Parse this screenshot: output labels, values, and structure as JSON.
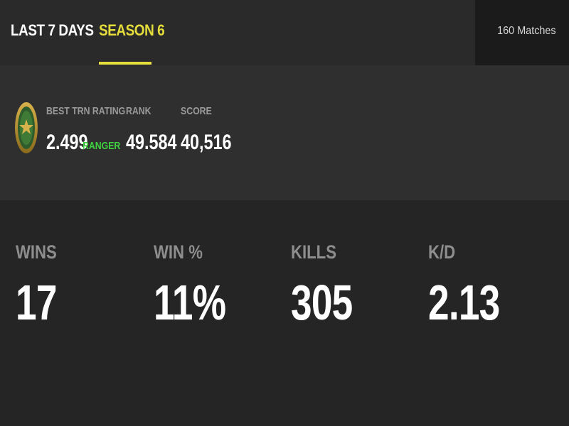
{
  "header": {
    "tabs": [
      {
        "label": "LAST 7 DAYS",
        "active": false
      },
      {
        "label": "SEASON 6",
        "active": true
      }
    ],
    "matches_label": "160 Matches"
  },
  "rating": {
    "badge_icon": "ranger-rank-badge-icon",
    "best_trn_rating": {
      "label": "BEST TRN RATING",
      "value": "2.499",
      "rank_name": "RANGER"
    },
    "rank": {
      "label": "RANK",
      "value": "49.584"
    },
    "score": {
      "label": "SCORE",
      "value": "40,516"
    }
  },
  "stats": [
    {
      "label": "WINS",
      "value": "17"
    },
    {
      "label": "WIN %",
      "value": "11%"
    },
    {
      "label": "KILLS",
      "value": "305"
    },
    {
      "label": "K/D",
      "value": "2.13"
    }
  ],
  "colors": {
    "accent_yellow": "#e4dd3b",
    "rank_green": "#3fd33f",
    "background": "#252525",
    "panel": "#2f2f2f"
  }
}
